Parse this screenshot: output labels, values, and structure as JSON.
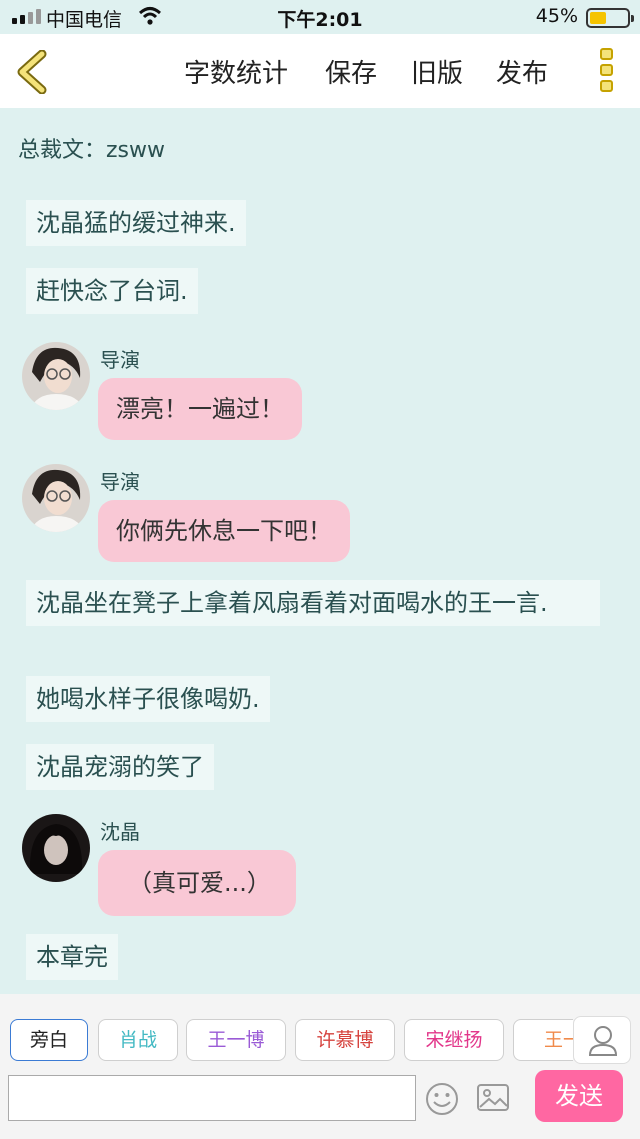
{
  "status_bar": {
    "carrier": "中国电信",
    "time": "下午2:01",
    "battery": "45%",
    "battery_level": 0.45
  },
  "nav": {
    "word_count": "字数统计",
    "save": "保存",
    "old_version": "旧版",
    "publish": "发布",
    "back_icon": "chevron-left-icon",
    "more_icon": "vertical-dots-icon"
  },
  "author": {
    "label": "总裁文：zsww"
  },
  "messages": [
    {
      "type": "narration",
      "text": "沈晶猛的缓过神来."
    },
    {
      "type": "narration",
      "text": "赶快念了台词."
    },
    {
      "type": "dialogue",
      "speaker": "导演",
      "text": "漂亮！一遍过！"
    },
    {
      "type": "dialogue",
      "speaker": "导演",
      "text": "你俩先休息一下吧！"
    },
    {
      "type": "narration",
      "text": "沈晶坐在凳子上拿着风扇看着对面喝水的王一言."
    },
    {
      "type": "narration",
      "text": "她喝水样子很像喝奶."
    },
    {
      "type": "narration",
      "text": "沈晶宠溺的笑了"
    },
    {
      "type": "dialogue",
      "speaker": "沈晶",
      "text": "（真可爱...）"
    },
    {
      "type": "narration",
      "text": "本章完"
    }
  ],
  "characters": [
    {
      "label": "旁白",
      "color": "#222222",
      "border": "#3b7bd4"
    },
    {
      "label": "肖战",
      "color": "#43b9c3",
      "border": "#cfcfcf"
    },
    {
      "label": "王一博",
      "color": "#9a5bd6",
      "border": "#cfcfcf"
    },
    {
      "label": "许慕博",
      "color": "#d6433e",
      "border": "#cfcfcf"
    },
    {
      "label": "宋继扬",
      "color": "#e2368a",
      "border": "#cfcfcf"
    },
    {
      "label": "王一",
      "color": "#f08a4b",
      "border": "#cfcfcf"
    }
  ],
  "composer": {
    "input_value": "",
    "send": "发送",
    "emoji_icon": "smiley-icon",
    "image_icon": "image-icon",
    "user_icon": "user-icon"
  },
  "colors": {
    "background": "#dff1f0",
    "bubble": "#f9c8d5",
    "send_button": "#ff67a2"
  }
}
